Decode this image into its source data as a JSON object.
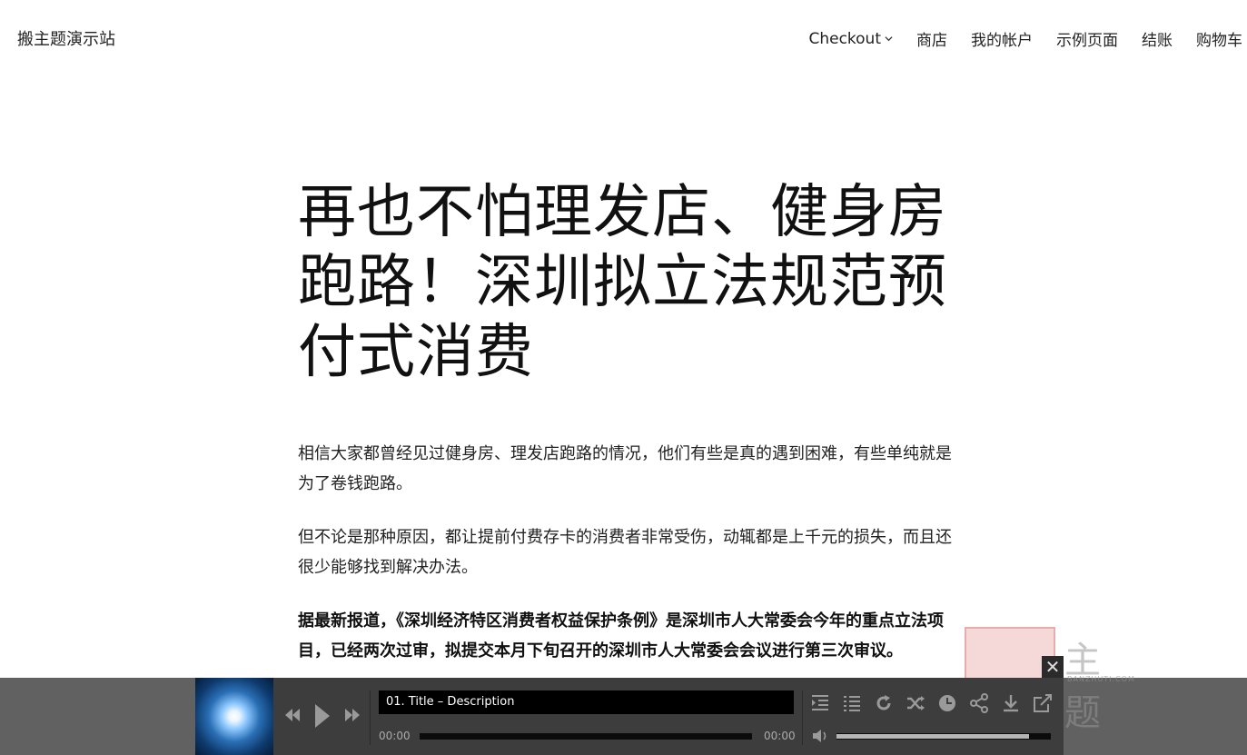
{
  "site": {
    "title": "搬主题演示站"
  },
  "nav": {
    "items": [
      "Checkout",
      "商店",
      "我的帐户",
      "示例页面",
      "结账",
      "购物车"
    ]
  },
  "post": {
    "title": "再也不怕理发店、健身房跑路！深圳拟立法规范预付式消费",
    "paragraphs": [
      "相信大家都曾经见过健身房、理发店跑路的情况，他们有些是真的遇到困难，有些单纯就是为了卷钱跑路。",
      "但不论是那种原因，都让提前付费存卡的消费者非常受伤，动辄都是上千元的损失，而且还很少能够找到解决办法。",
      "据最新报道，《深圳经济特区消费者权益保护条例》是深圳市人大常委会今年的重点立法项目，已经两次过审，拟提交本月下旬召开的深圳市人大常委会会议进行第三次审议。"
    ]
  },
  "watermark": {
    "text": "主 题",
    "small": "BANZHUTI.COM"
  },
  "player": {
    "track_title": "01. Title – Description",
    "time_current": "00:00",
    "time_total": "00:00",
    "progress": 0,
    "volume": 0.9,
    "close": "✕"
  }
}
